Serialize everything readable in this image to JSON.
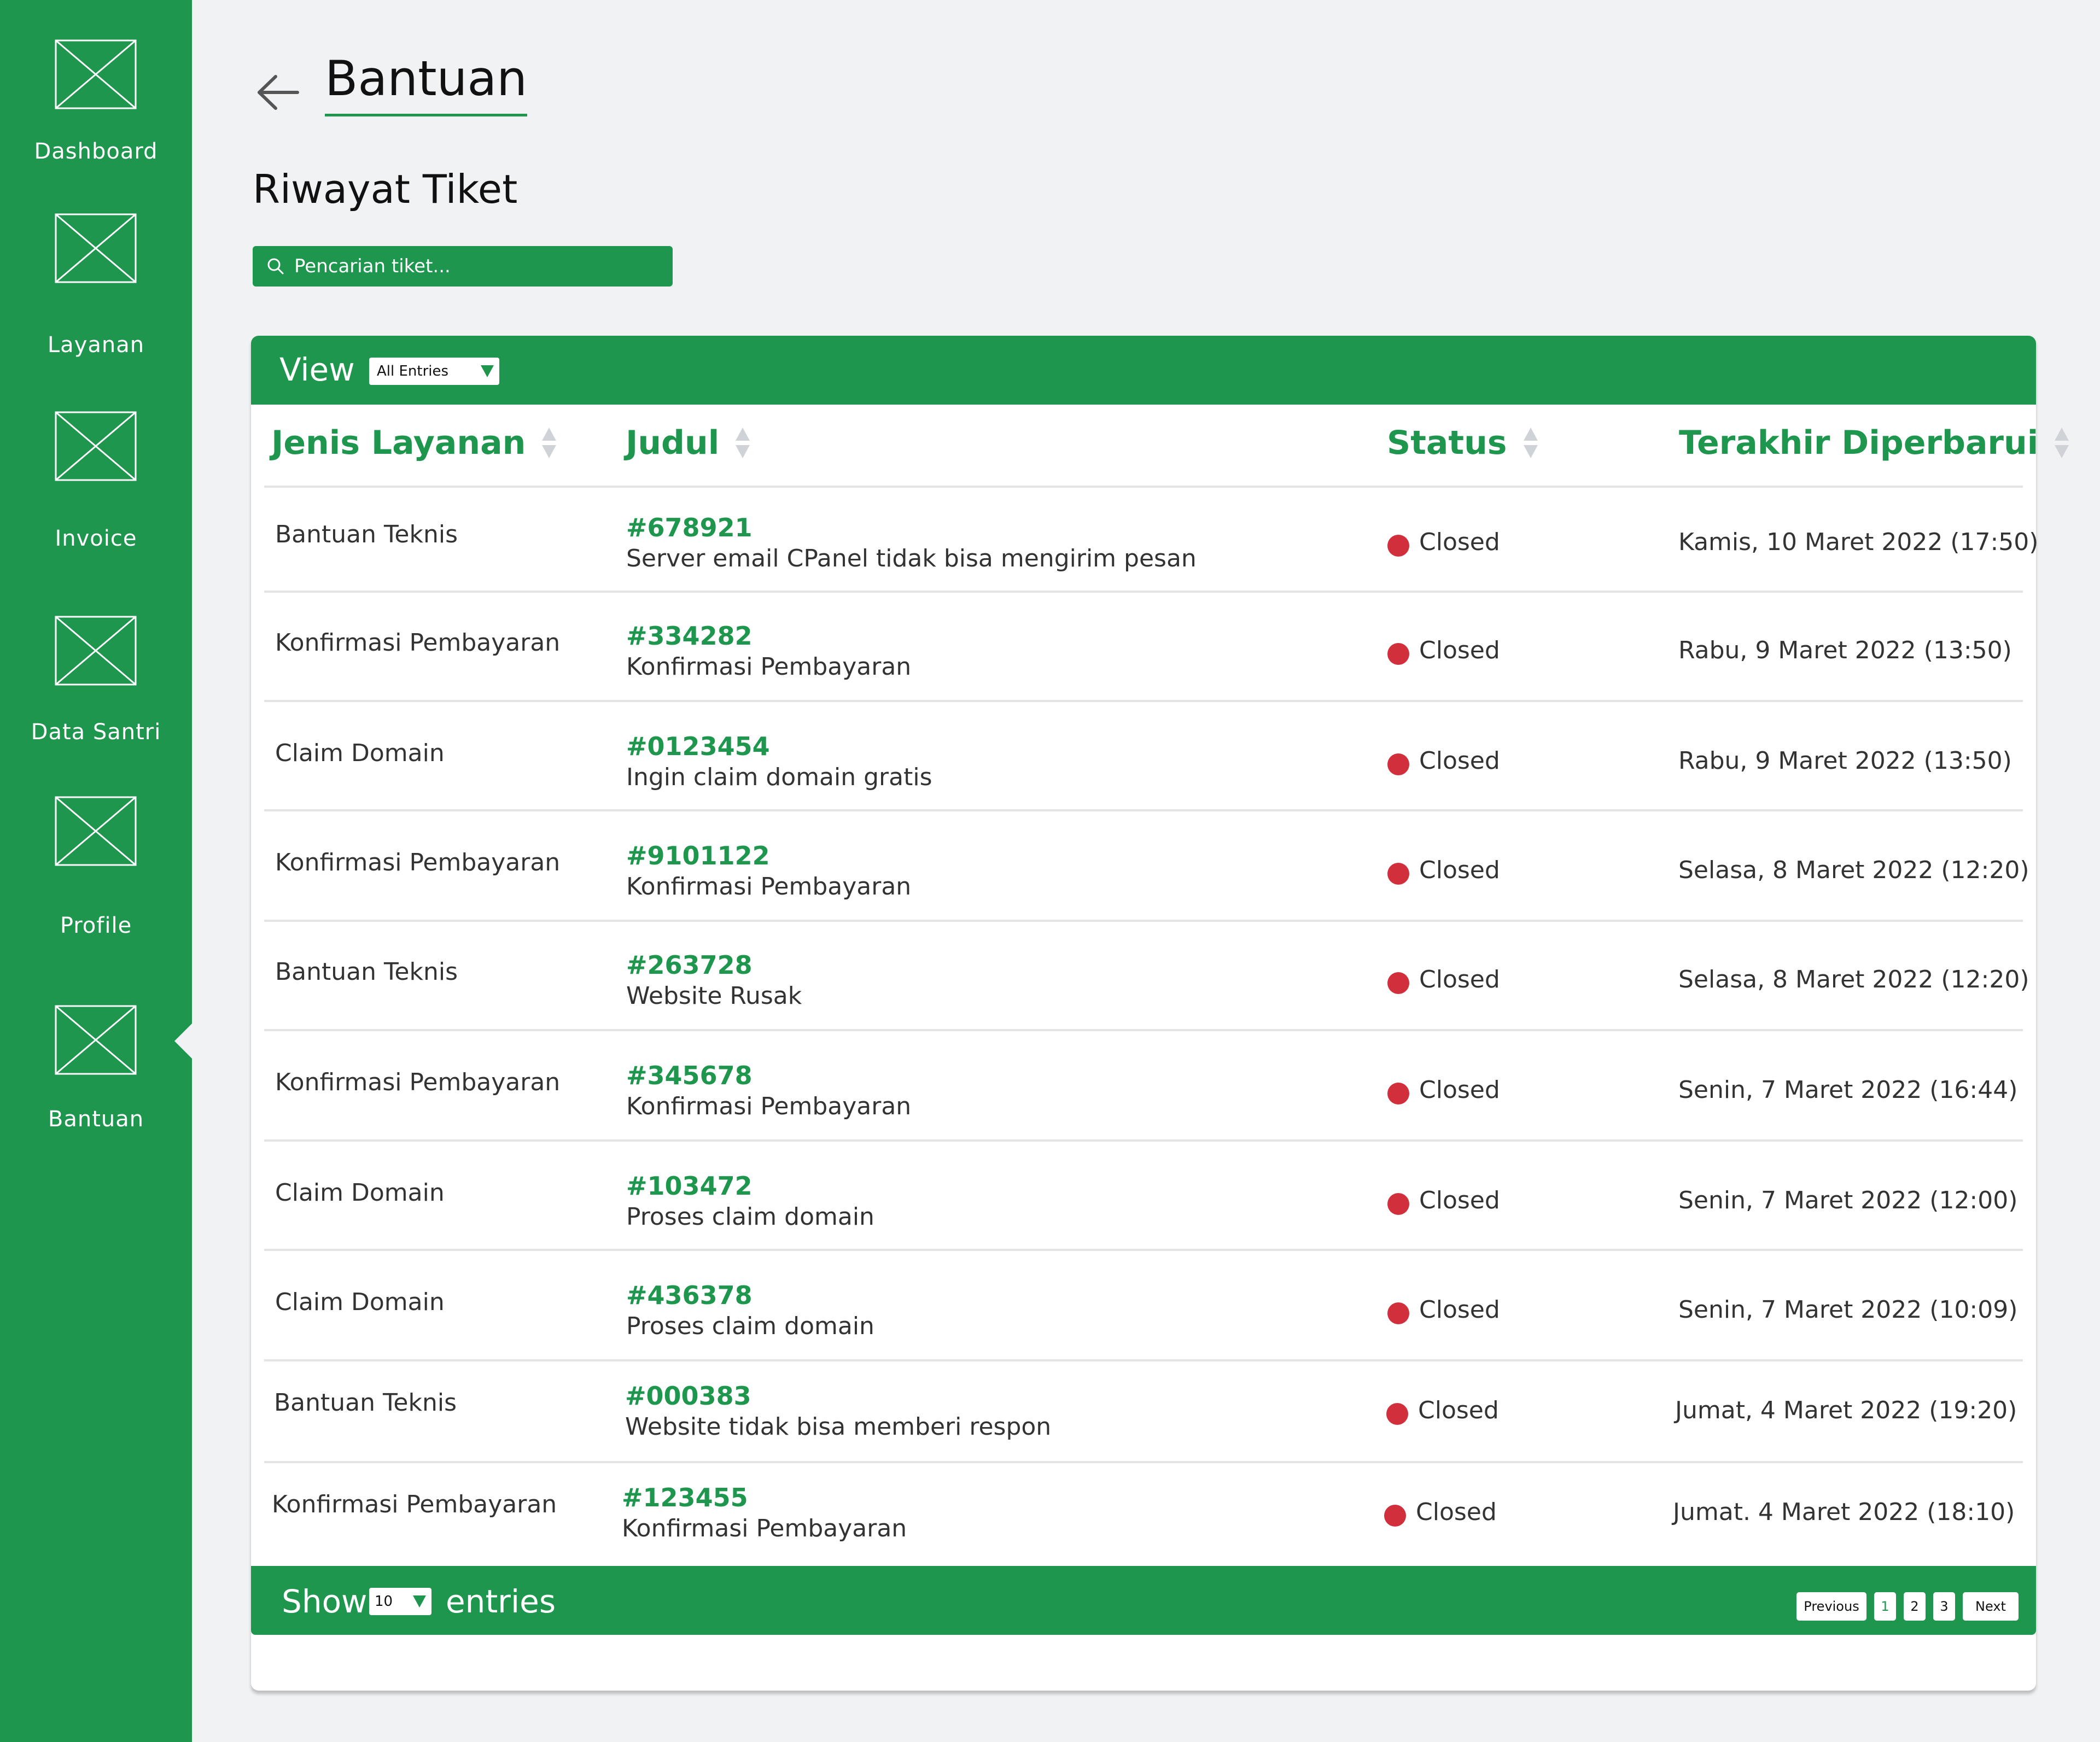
{
  "sidebar": {
    "items": [
      {
        "label": "Dashboard"
      },
      {
        "label": "Layanan"
      },
      {
        "label": "Invoice"
      },
      {
        "label": "Data Santri"
      },
      {
        "label": "Profile"
      },
      {
        "label": "Bantuan",
        "active": true
      }
    ]
  },
  "header": {
    "title": "Bantuan"
  },
  "section": {
    "title": "Riwayat Tiket"
  },
  "search": {
    "placeholder": "Pencarian tiket..."
  },
  "table": {
    "view_label": "View",
    "view_select": "All Entries",
    "columns": [
      "Jenis Layanan",
      "Judul",
      "Status",
      "Terakhir Diperbarui"
    ],
    "rows": [
      {
        "jenis": "Bantuan Teknis",
        "id": "#678921",
        "title": "Server email CPanel tidak bisa mengirim pesan",
        "status": "Closed",
        "date": "Kamis, 10 Maret 2022 (17:50)"
      },
      {
        "jenis": "Konfirmasi Pembayaran",
        "id": "#334282",
        "title": "Konfirmasi Pembayaran",
        "status": "Closed",
        "date": "Rabu, 9 Maret 2022 (13:50)"
      },
      {
        "jenis": "Claim Domain",
        "id": "#0123454",
        "title": "Ingin claim domain gratis",
        "status": "Closed",
        "date": "Rabu, 9 Maret 2022 (13:50)"
      },
      {
        "jenis": "Konfirmasi Pembayaran",
        "id": "#9101122",
        "title": "Konfirmasi Pembayaran",
        "status": "Closed",
        "date": "Selasa, 8 Maret 2022 (12:20)"
      },
      {
        "jenis": "Bantuan Teknis",
        "id": "#263728",
        "title": "Website Rusak",
        "status": "Closed",
        "date": "Selasa, 8 Maret 2022 (12:20)"
      },
      {
        "jenis": "Konfirmasi Pembayaran",
        "id": "#345678",
        "title": "Konfirmasi Pembayaran",
        "status": "Closed",
        "date": "Senin, 7 Maret 2022 (16:44)"
      },
      {
        "jenis": "Claim Domain",
        "id": "#103472",
        "title": "Proses claim domain",
        "status": "Closed",
        "date": "Senin, 7 Maret 2022 (12:00)"
      },
      {
        "jenis": "Claim Domain",
        "id": "#436378",
        "title": "Proses claim domain",
        "status": "Closed",
        "date": "Senin, 7 Maret 2022 (10:09)"
      },
      {
        "jenis": "Bantuan Teknis",
        "id": "#000383",
        "title": "Website tidak bisa memberi respon",
        "status": "Closed",
        "date": "Jumat, 4 Maret 2022 (19:20)"
      },
      {
        "jenis": "Konfirmasi Pembayaran",
        "id": "#123455",
        "title": "Konfirmasi Pembayaran",
        "status": "Closed",
        "date": "Jumat. 4 Maret 2022 (18:10)"
      }
    ]
  },
  "footer": {
    "show_label": "Show",
    "entries_value": "10",
    "entries_label": "entries",
    "pagination": {
      "previous": "Previous",
      "pages": [
        "1",
        "2",
        "3"
      ],
      "current": "1",
      "next": "Next"
    }
  },
  "colors": {
    "brand": "#1e964d",
    "status_closed": "#d12f3c",
    "background": "#f1f2f4"
  }
}
